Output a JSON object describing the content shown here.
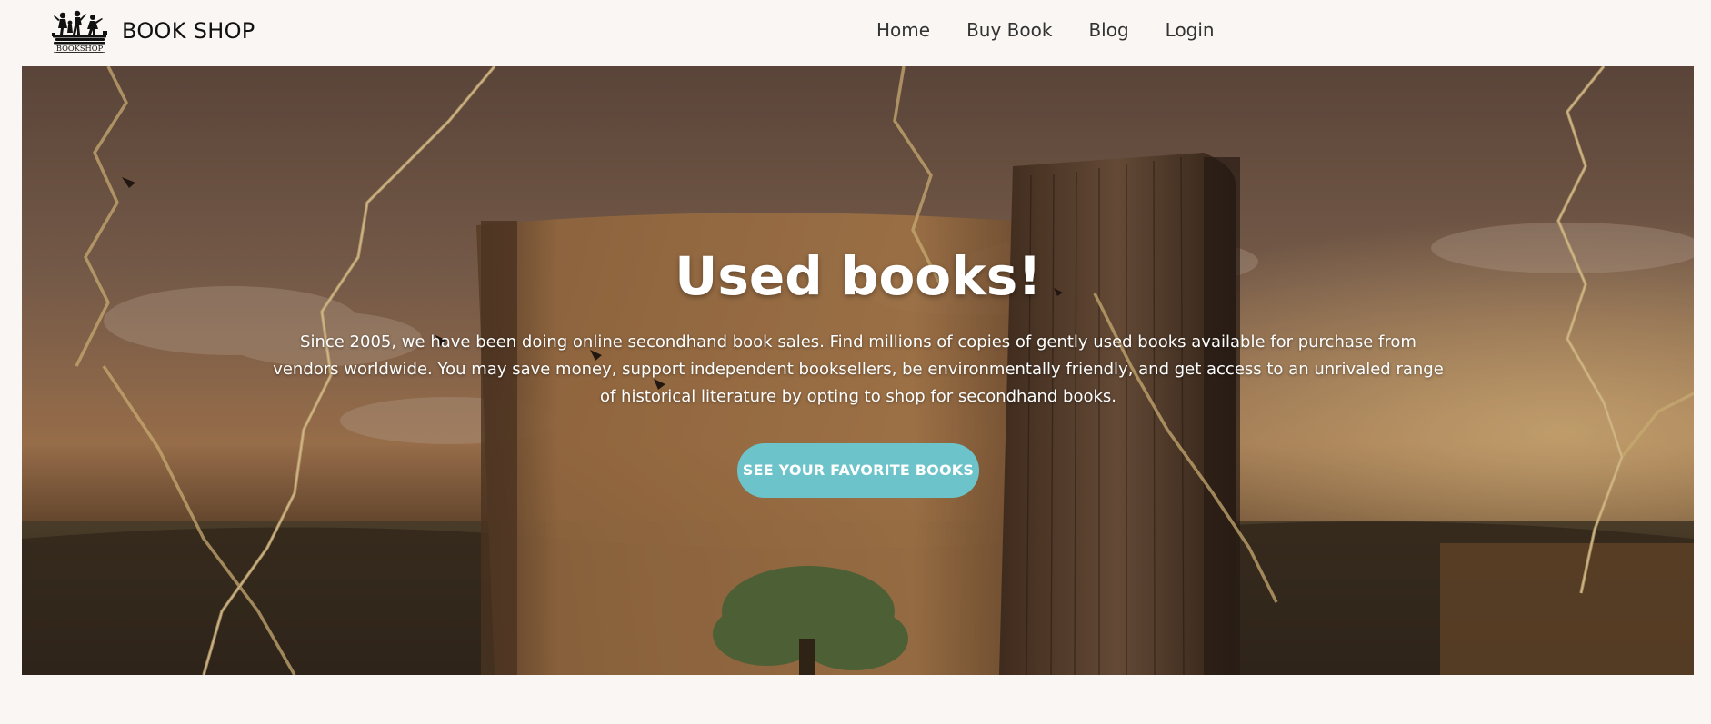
{
  "navbar": {
    "brand_name": "BOOK SHOP",
    "logo_text": "BOOKSHOP",
    "links": [
      {
        "label": "Home"
      },
      {
        "label": "Buy Book"
      },
      {
        "label": "Blog"
      },
      {
        "label": "Login"
      }
    ]
  },
  "hero": {
    "title": "Used books!",
    "description": "Since 2005, we have been doing online secondhand book sales. Find millions of copies of gently used books available for purchase from vendors worldwide. You may save money, support independent booksellers, be environmentally friendly, and get access to an unrivaled range of historical literature by opting to shop for secondhand books.",
    "cta_label": "SEE YOUR FAVORITE BOOKS",
    "background_image": "open-book-in-field-with-lightning"
  },
  "colors": {
    "page_background": "#faf6f3",
    "cta_background": "#6cc3c9",
    "hero_text": "#ffffff",
    "nav_text": "#333333"
  }
}
